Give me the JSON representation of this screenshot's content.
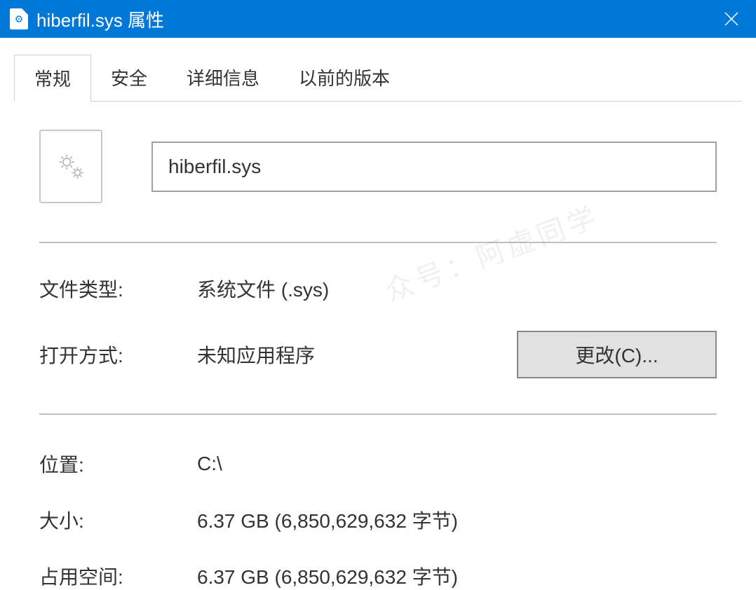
{
  "window": {
    "title": "hiberfil.sys 属性",
    "close": "✕"
  },
  "tabs": {
    "general": "常规",
    "security": "安全",
    "details": "详细信息",
    "previous_versions": "以前的版本"
  },
  "file": {
    "name": "hiberfil.sys"
  },
  "props": {
    "filetype_label": "文件类型:",
    "filetype_value": "系统文件 (.sys)",
    "openwith_label": "打开方式:",
    "openwith_value": "未知应用程序",
    "change_button": "更改(C)...",
    "location_label": "位置:",
    "location_value": "C:\\",
    "size_label": "大小:",
    "size_value": "6.37 GB (6,850,629,632 字节)",
    "size_on_disk_label": "占用空间:",
    "size_on_disk_value": "6.37 GB (6,850,629,632 字节)"
  },
  "watermark": "众号：阿虚同学"
}
